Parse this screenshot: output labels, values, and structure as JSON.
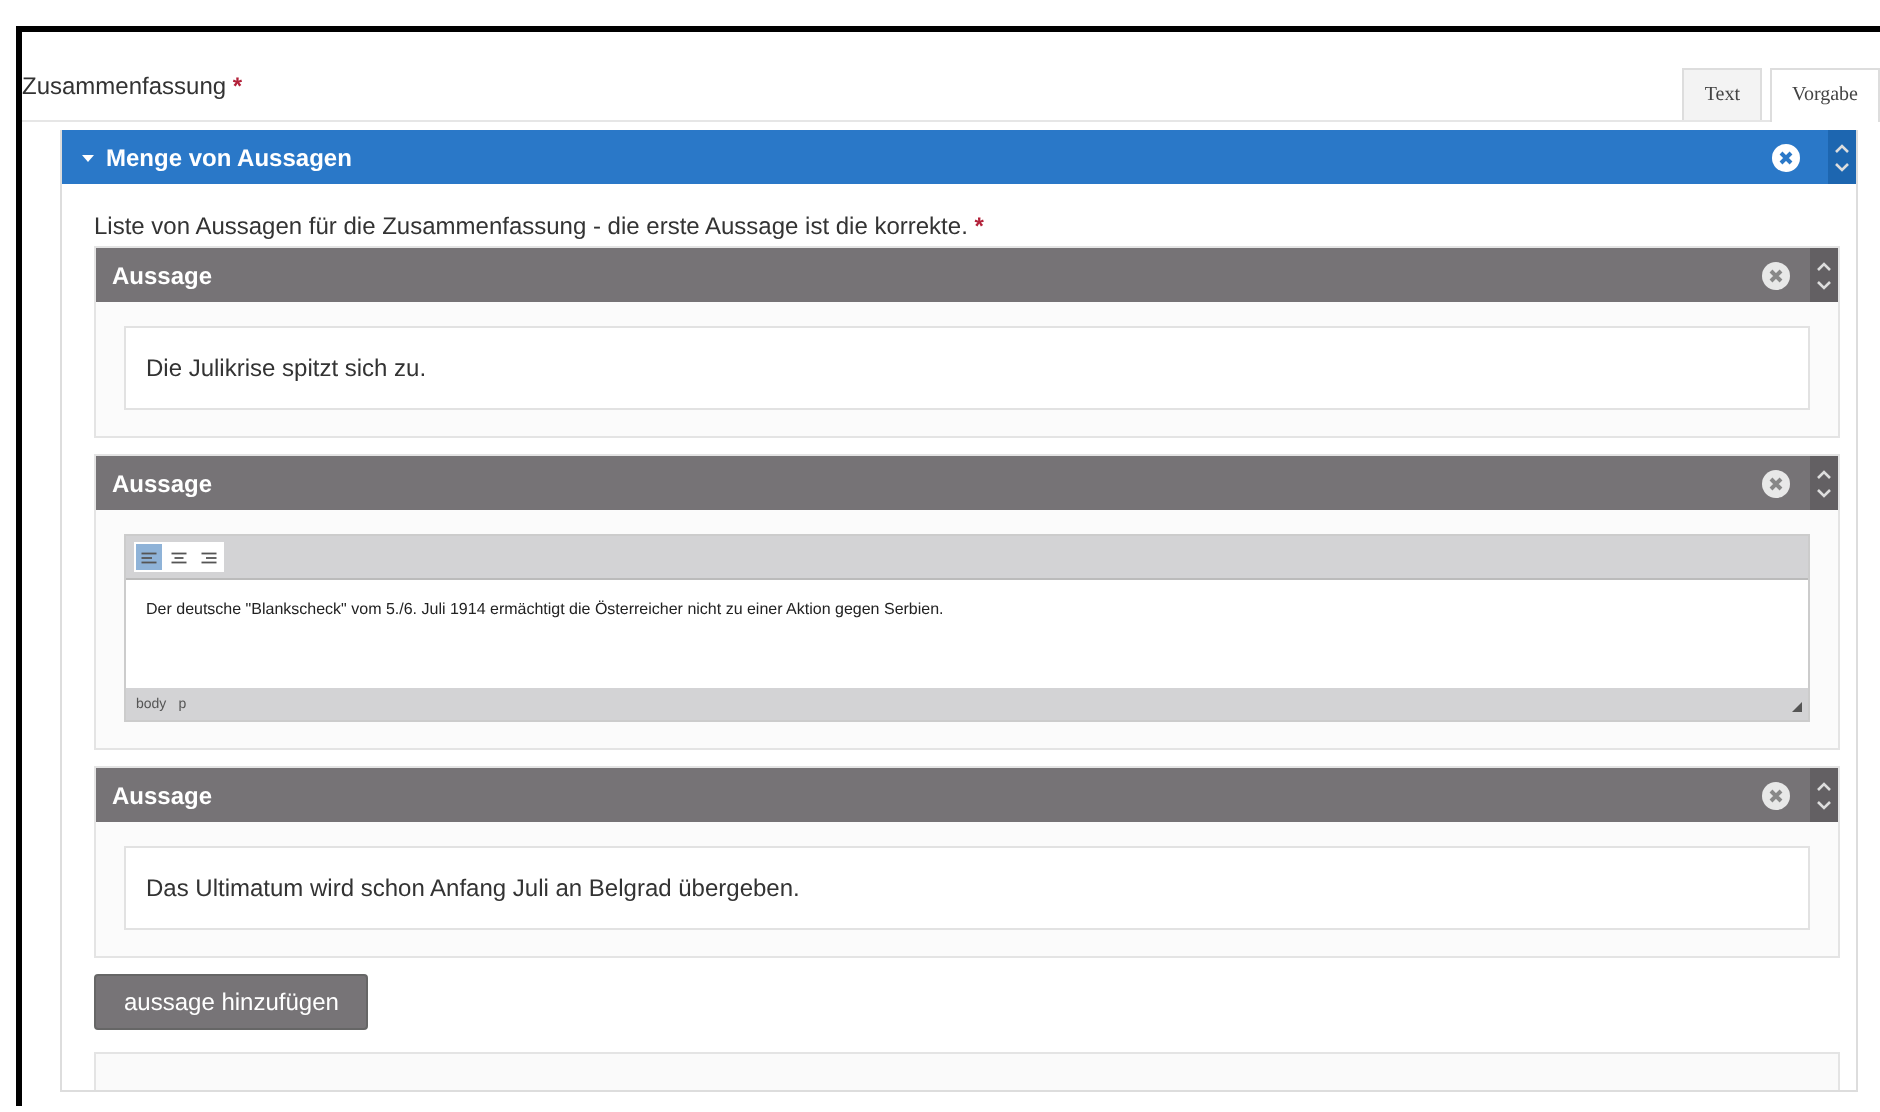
{
  "field": {
    "label": "Zusammenfassung",
    "required_mark": "*"
  },
  "tabs": [
    {
      "label": "Text",
      "selected": false
    },
    {
      "label": "Vorgabe",
      "selected": true
    }
  ],
  "group": {
    "title": "Menge von Aussagen",
    "expanded": true,
    "description": "Liste von Aussagen für die Zusammenfassung - die erste Aussage ist die korrekte.",
    "required_mark": "*",
    "items": [
      {
        "kind": "text",
        "title": "Aussage",
        "value": "Die Julikrise spitzt sich zu."
      },
      {
        "kind": "editor",
        "title": "Aussage",
        "value": "Der deutsche \"Blankscheck\" vom 5./6. Juli 1914 ermächtigt die Österreicher nicht zu einer Aktion gegen Serbien.",
        "align": [
          {
            "selected": true
          },
          {
            "selected": false
          },
          {
            "selected": false
          }
        ],
        "path": [
          "body",
          "p"
        ]
      },
      {
        "kind": "text",
        "title": "Aussage",
        "value": "Das Ultimatum wird schon Anfang Juli an Belgrad übergeben."
      }
    ]
  },
  "add_button": "aussage hinzufügen"
}
